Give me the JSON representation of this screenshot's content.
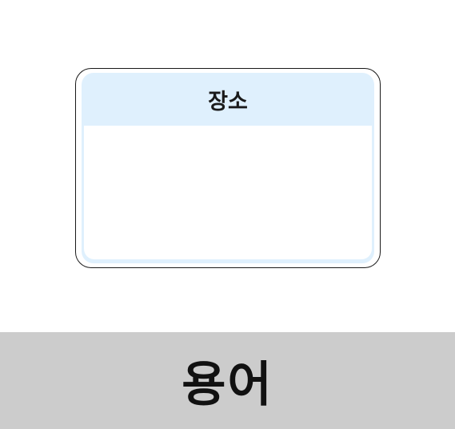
{
  "card": {
    "header_label": "장소",
    "body_text": ""
  },
  "footer": {
    "word": "용어"
  },
  "colors": {
    "card_header_bg": "#dff0fd",
    "card_border": "#1a1a1a",
    "footer_bg": "#cccccc"
  }
}
